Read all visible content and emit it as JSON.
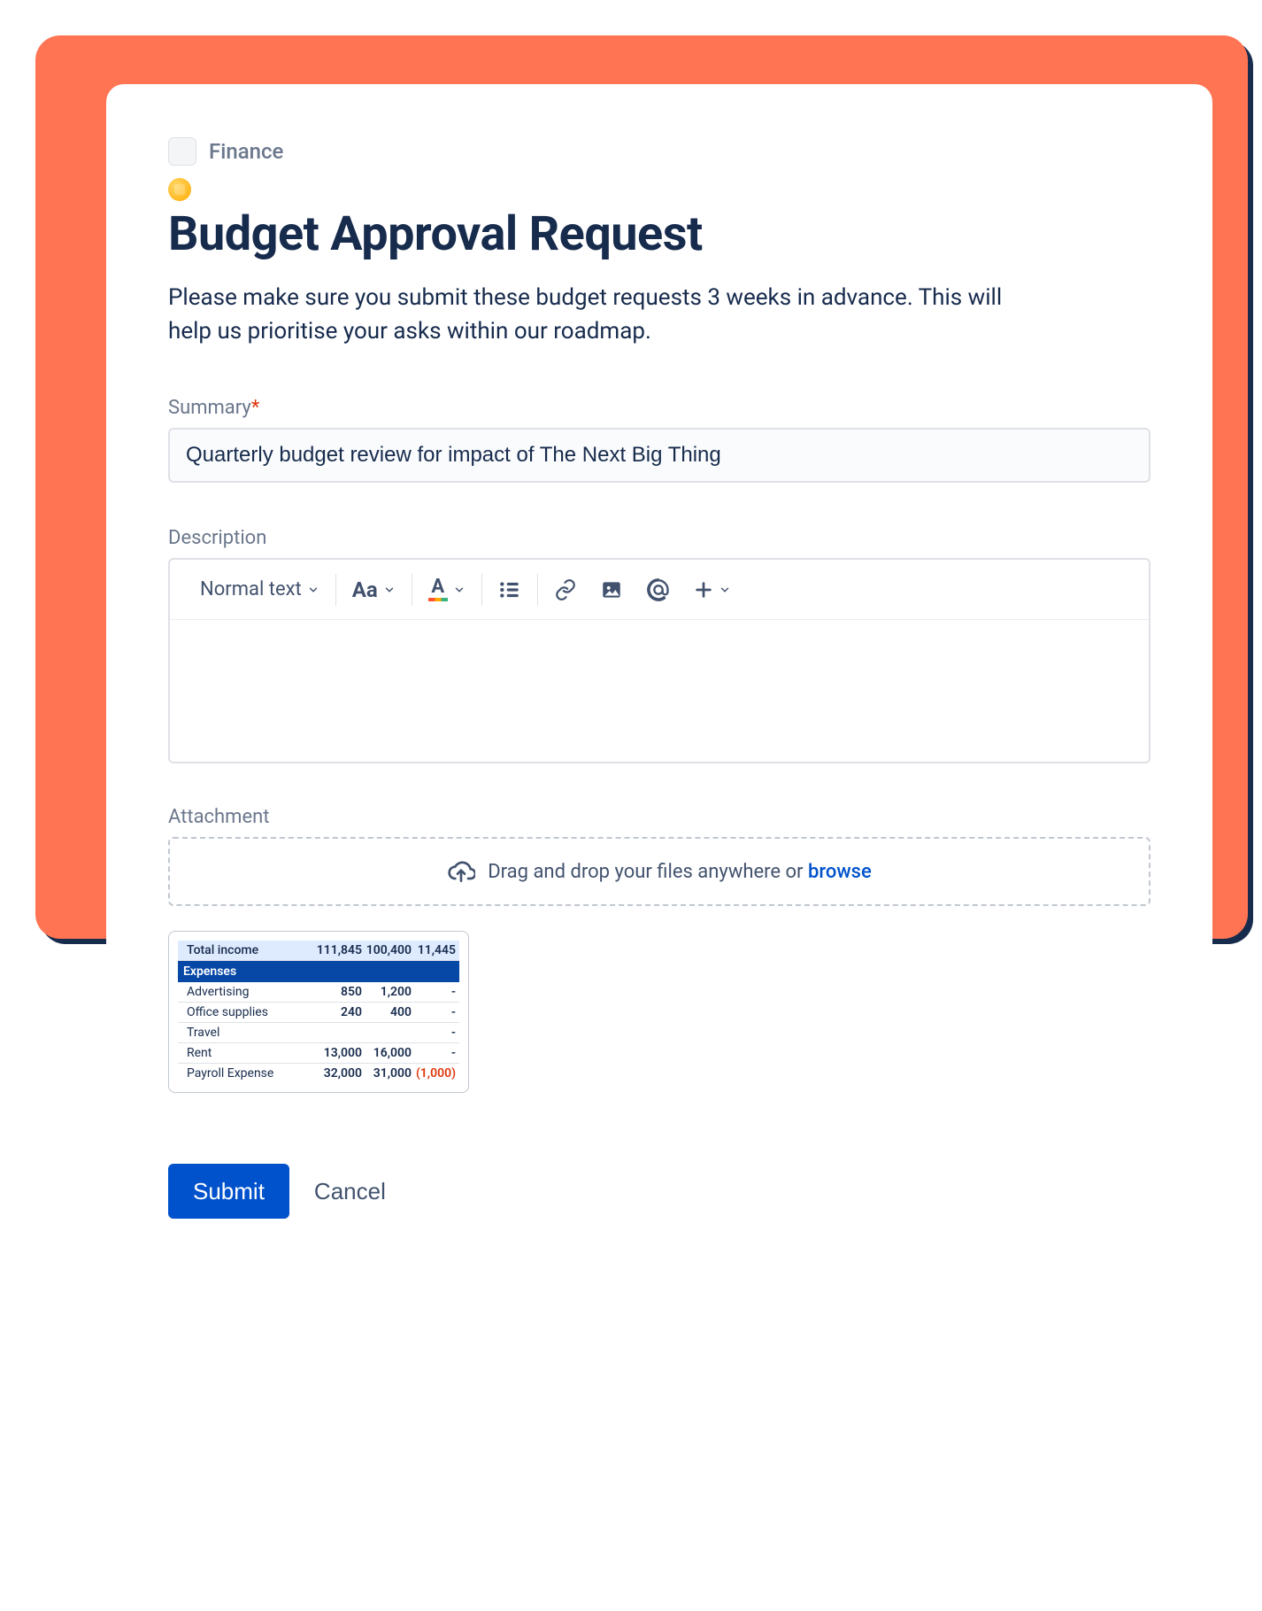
{
  "breadcrumb": {
    "label": "Finance"
  },
  "header": {
    "title": "Budget Approval Request",
    "intro": "Please make sure you submit these budget requests 3 weeks in advance. This will help us prioritise your asks within our roadmap."
  },
  "summary": {
    "label": "Summary",
    "required": "*",
    "value": "Quarterly budget review for impact of The Next Big Thing"
  },
  "description": {
    "label": "Description",
    "toolbar": {
      "text_style": "Normal text"
    }
  },
  "attachment": {
    "label": "Attachment",
    "hint_prefix": "Drag and drop your files anywhere or ",
    "browse": "browse"
  },
  "thumbnail": {
    "income_row": {
      "label": "Total income",
      "c1": "111,845",
      "c2": "100,400",
      "c3": "11,445"
    },
    "banner": "Expenses",
    "rows": [
      {
        "label": "Advertising",
        "c1": "850",
        "c2": "1,200",
        "c3": "-"
      },
      {
        "label": "Office supplies",
        "c1": "240",
        "c2": "400",
        "c3": "-"
      },
      {
        "label": "Travel",
        "c1": "",
        "c2": "",
        "c3": "-"
      },
      {
        "label": "Rent",
        "c1": "13,000",
        "c2": "16,000",
        "c3": "-"
      },
      {
        "label": "Payroll Expense",
        "c1": "32,000",
        "c2": "31,000",
        "c3": "(1,000)",
        "neg": true
      }
    ]
  },
  "actions": {
    "submit": "Submit",
    "cancel": "Cancel"
  }
}
